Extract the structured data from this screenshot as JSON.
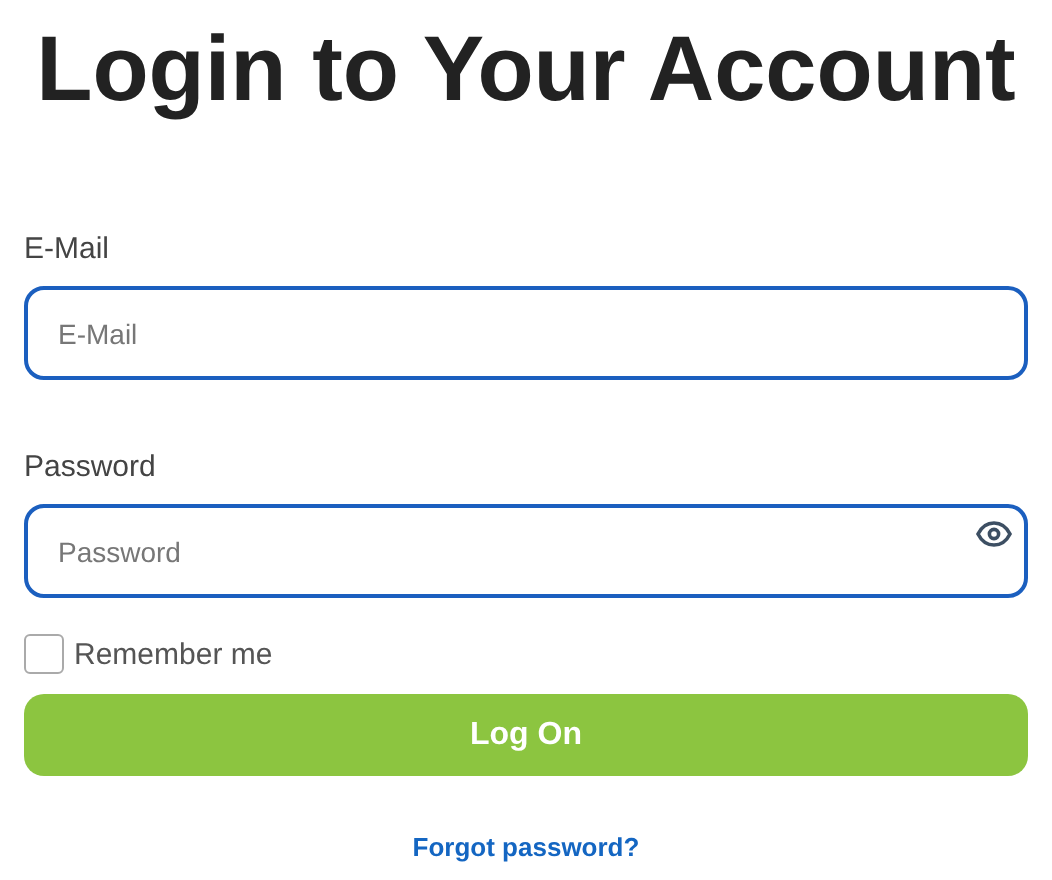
{
  "title": "Login to Your Account",
  "email": {
    "label": "E-Mail",
    "placeholder": "E-Mail"
  },
  "password": {
    "label": "Password",
    "placeholder": "Password"
  },
  "remember": {
    "label": "Remember me",
    "checked": false
  },
  "submit": "Log On",
  "forgot_link": "Forgot password?"
}
